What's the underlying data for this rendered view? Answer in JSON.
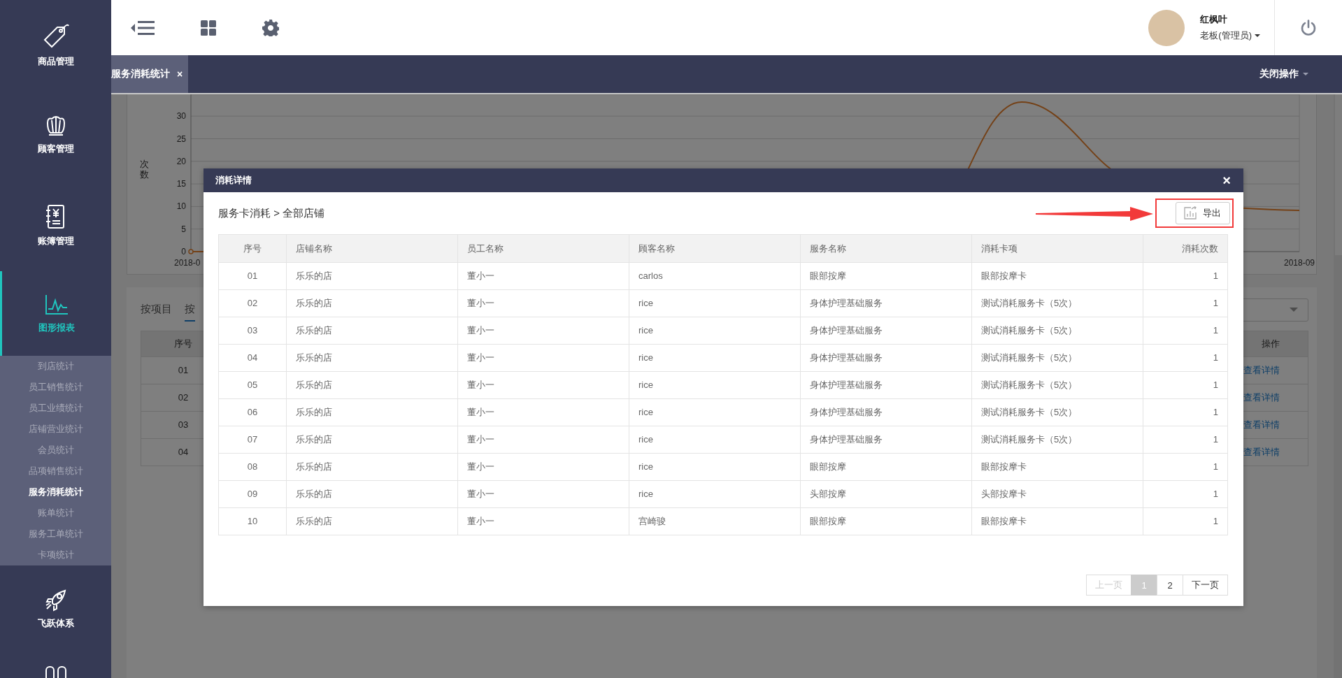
{
  "top_bar": {
    "user_name": "红枫叶",
    "user_role": "老板(管理员)"
  },
  "sidebar": {
    "items": [
      {
        "label": "商品管理",
        "selected": false
      },
      {
        "label": "顾客管理",
        "selected": false
      },
      {
        "label": "账簿管理",
        "selected": false
      },
      {
        "label": "图形报表",
        "selected": true,
        "children": [
          {
            "label": "到店统计",
            "selected": false
          },
          {
            "label": "员工销售统计",
            "selected": false
          },
          {
            "label": "员工业绩统计",
            "selected": false
          },
          {
            "label": "店铺营业统计",
            "selected": false
          },
          {
            "label": "会员统计",
            "selected": false
          },
          {
            "label": "品项销售统计",
            "selected": false
          },
          {
            "label": "服务消耗统计",
            "selected": true
          },
          {
            "label": "账单统计",
            "selected": false
          },
          {
            "label": "服务工单统计",
            "selected": false
          },
          {
            "label": "卡项统计",
            "selected": false
          }
        ]
      },
      {
        "label": "飞跃体系",
        "selected": false
      }
    ]
  },
  "tabs": [
    {
      "label": "服务消耗统计",
      "selected": true,
      "close": "×"
    }
  ],
  "tab_actions": {
    "label": "关闭操作"
  },
  "background": {
    "chart": {
      "y_axis_label": "次数",
      "y_ticks": [
        "30",
        "25",
        "20",
        "15",
        "10",
        "5",
        "0"
      ],
      "x_labels": [
        "2018-0",
        "2018-09"
      ]
    },
    "view_tabs": [
      {
        "label": "按项目",
        "selected": false
      },
      {
        "label": "按",
        "selected": true
      }
    ],
    "table": {
      "columns": [
        "序号",
        "操作"
      ],
      "rows": [
        {
          "index": "01",
          "action": "查看详情"
        },
        {
          "index": "02",
          "action": "查看详情"
        },
        {
          "index": "03",
          "action": "查看详情"
        },
        {
          "index": "04",
          "action": "查看详情"
        }
      ]
    }
  },
  "dialog": {
    "title": "消耗详情",
    "close": "×",
    "breadcrumb": "服务卡消耗 > 全部店铺",
    "export_button": "导出",
    "table": {
      "columns": [
        "序号",
        "店铺名称",
        "员工名称",
        "顾客名称",
        "服务名称",
        "消耗卡项",
        "消耗次数"
      ],
      "rows": [
        [
          "01",
          "乐乐的店",
          "董小一",
          "carlos",
          "眼部按摩",
          "眼部按摩卡",
          "1"
        ],
        [
          "02",
          "乐乐的店",
          "董小一",
          "rice",
          "身体护理基础服务",
          "测试消耗服务卡（5次）",
          "1"
        ],
        [
          "03",
          "乐乐的店",
          "董小一",
          "rice",
          "身体护理基础服务",
          "测试消耗服务卡（5次）",
          "1"
        ],
        [
          "04",
          "乐乐的店",
          "董小一",
          "rice",
          "身体护理基础服务",
          "测试消耗服务卡（5次）",
          "1"
        ],
        [
          "05",
          "乐乐的店",
          "董小一",
          "rice",
          "身体护理基础服务",
          "测试消耗服务卡（5次）",
          "1"
        ],
        [
          "06",
          "乐乐的店",
          "董小一",
          "rice",
          "身体护理基础服务",
          "测试消耗服务卡（5次）",
          "1"
        ],
        [
          "07",
          "乐乐的店",
          "董小一",
          "rice",
          "身体护理基础服务",
          "测试消耗服务卡（5次）",
          "1"
        ],
        [
          "08",
          "乐乐的店",
          "董小一",
          "rice",
          "眼部按摩",
          "眼部按摩卡",
          "1"
        ],
        [
          "09",
          "乐乐的店",
          "董小一",
          "rice",
          "头部按摩",
          "头部按摩卡",
          "1"
        ],
        [
          "10",
          "乐乐的店",
          "董小一",
          "宫崎骏",
          "眼部按摩",
          "眼部按摩卡",
          "1"
        ]
      ]
    },
    "pagination": {
      "prev": {
        "label": "上一页",
        "disabled": true
      },
      "pages": [
        {
          "label": "1",
          "selected": true
        },
        {
          "label": "2",
          "selected": false
        }
      ],
      "next": {
        "label": "下一页",
        "disabled": false
      }
    }
  }
}
